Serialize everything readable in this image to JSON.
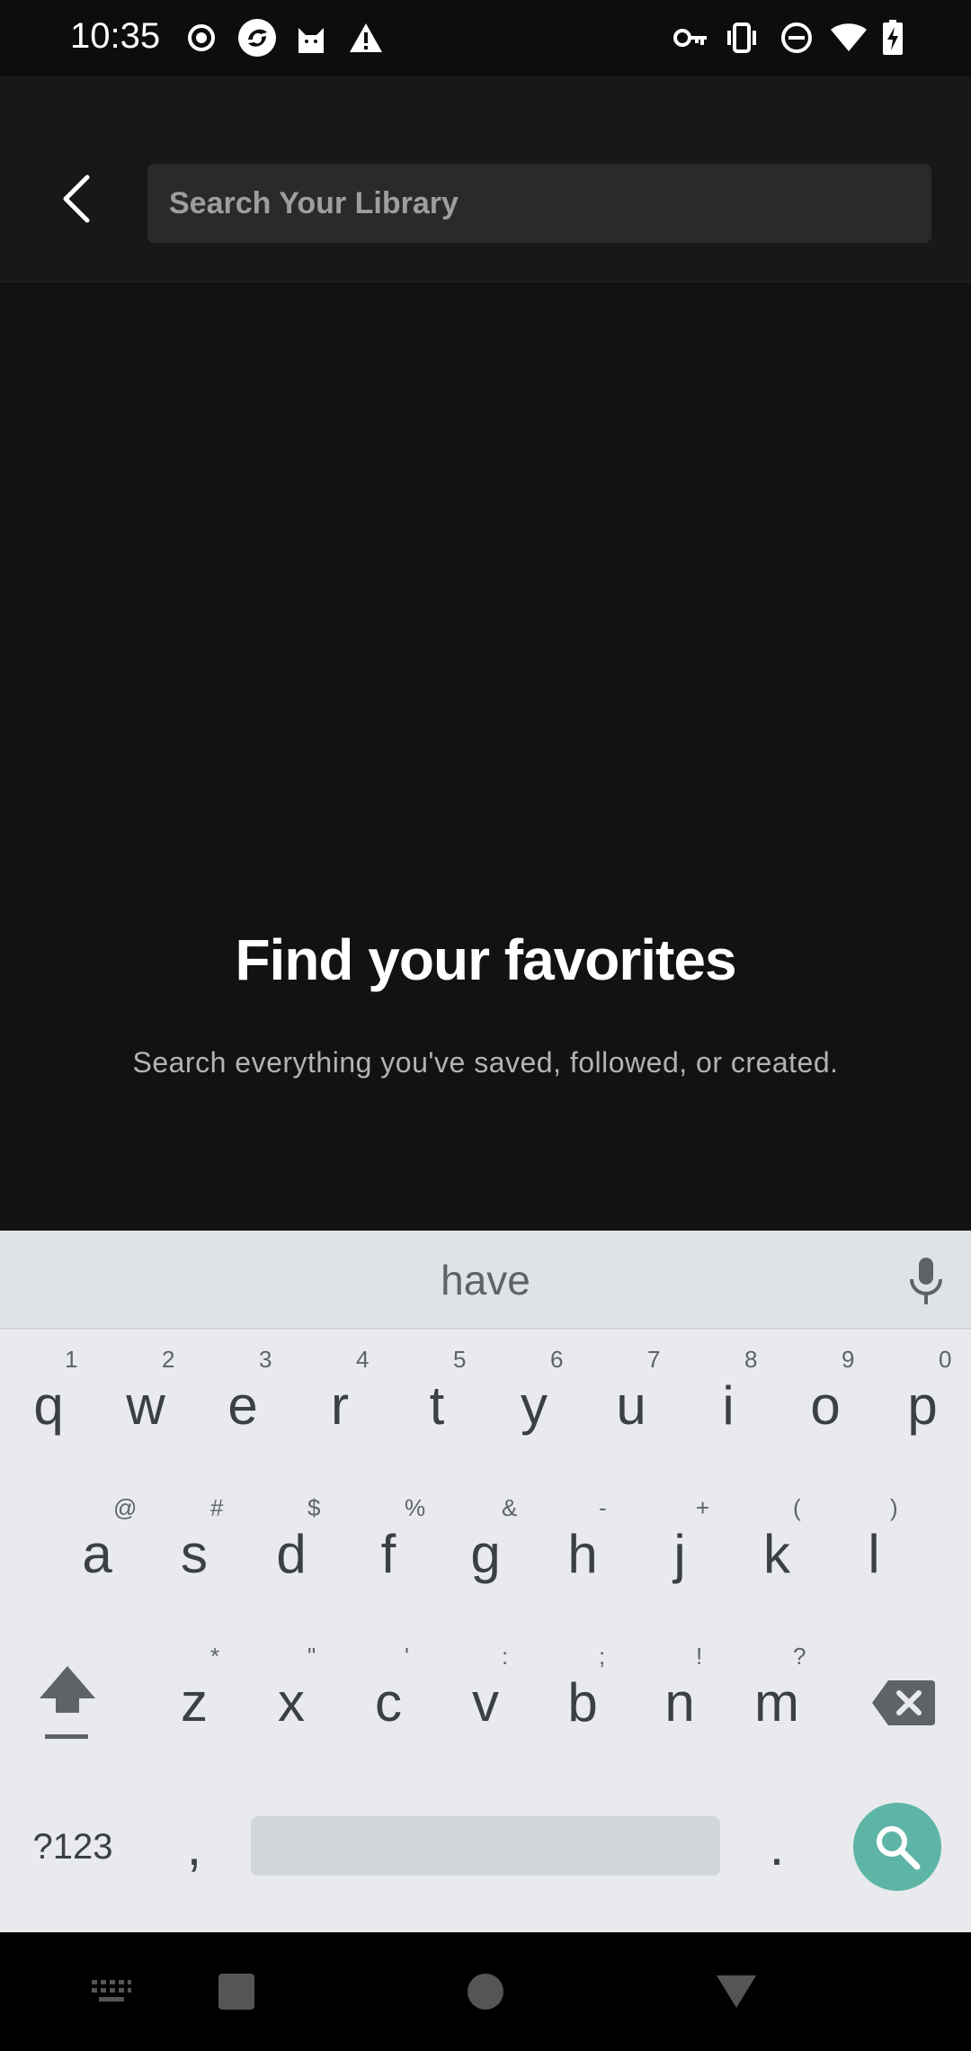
{
  "status_bar": {
    "time": "10:35",
    "left_icons": [
      "record-icon",
      "app-icon",
      "cat-icon",
      "warning-icon"
    ],
    "right_icons": [
      "vpn-key-icon",
      "vibrate-icon",
      "dnd-icon",
      "wifi-icon",
      "battery-charging-icon"
    ]
  },
  "header": {
    "search_placeholder": "Search Your Library",
    "search_value": ""
  },
  "empty_state": {
    "title": "Find your favorites",
    "subtitle": "Search everything you've saved, followed, or created."
  },
  "keyboard": {
    "suggestion": "have",
    "rows": [
      [
        {
          "k": "q",
          "h": "1"
        },
        {
          "k": "w",
          "h": "2"
        },
        {
          "k": "e",
          "h": "3"
        },
        {
          "k": "r",
          "h": "4"
        },
        {
          "k": "t",
          "h": "5"
        },
        {
          "k": "y",
          "h": "6"
        },
        {
          "k": "u",
          "h": "7"
        },
        {
          "k": "i",
          "h": "8"
        },
        {
          "k": "o",
          "h": "9"
        },
        {
          "k": "p",
          "h": "0"
        }
      ],
      [
        {
          "k": "a",
          "h": "@"
        },
        {
          "k": "s",
          "h": "#"
        },
        {
          "k": "d",
          "h": "$"
        },
        {
          "k": "f",
          "h": "%"
        },
        {
          "k": "g",
          "h": "&"
        },
        {
          "k": "h",
          "h": "-"
        },
        {
          "k": "j",
          "h": "+"
        },
        {
          "k": "k",
          "h": "("
        },
        {
          "k": "l",
          "h": ")"
        }
      ],
      [
        {
          "k": "z",
          "h": "*"
        },
        {
          "k": "x",
          "h": "\""
        },
        {
          "k": "c",
          "h": "'"
        },
        {
          "k": "v",
          "h": ":"
        },
        {
          "k": "b",
          "h": ";"
        },
        {
          "k": "n",
          "h": "!"
        },
        {
          "k": "m",
          "h": "?"
        }
      ]
    ],
    "symbols_label": "?123",
    "comma_label": ",",
    "period_label": "."
  },
  "nav_bar": {
    "buttons": [
      "keyboard-switch-icon",
      "recents-icon",
      "home-icon",
      "back-icon"
    ]
  },
  "colors": {
    "background": "#121212",
    "header": "#181818",
    "search_field": "#2a2a2a",
    "keyboard": "#e8eaed",
    "search_action": "#5eb5a6"
  }
}
